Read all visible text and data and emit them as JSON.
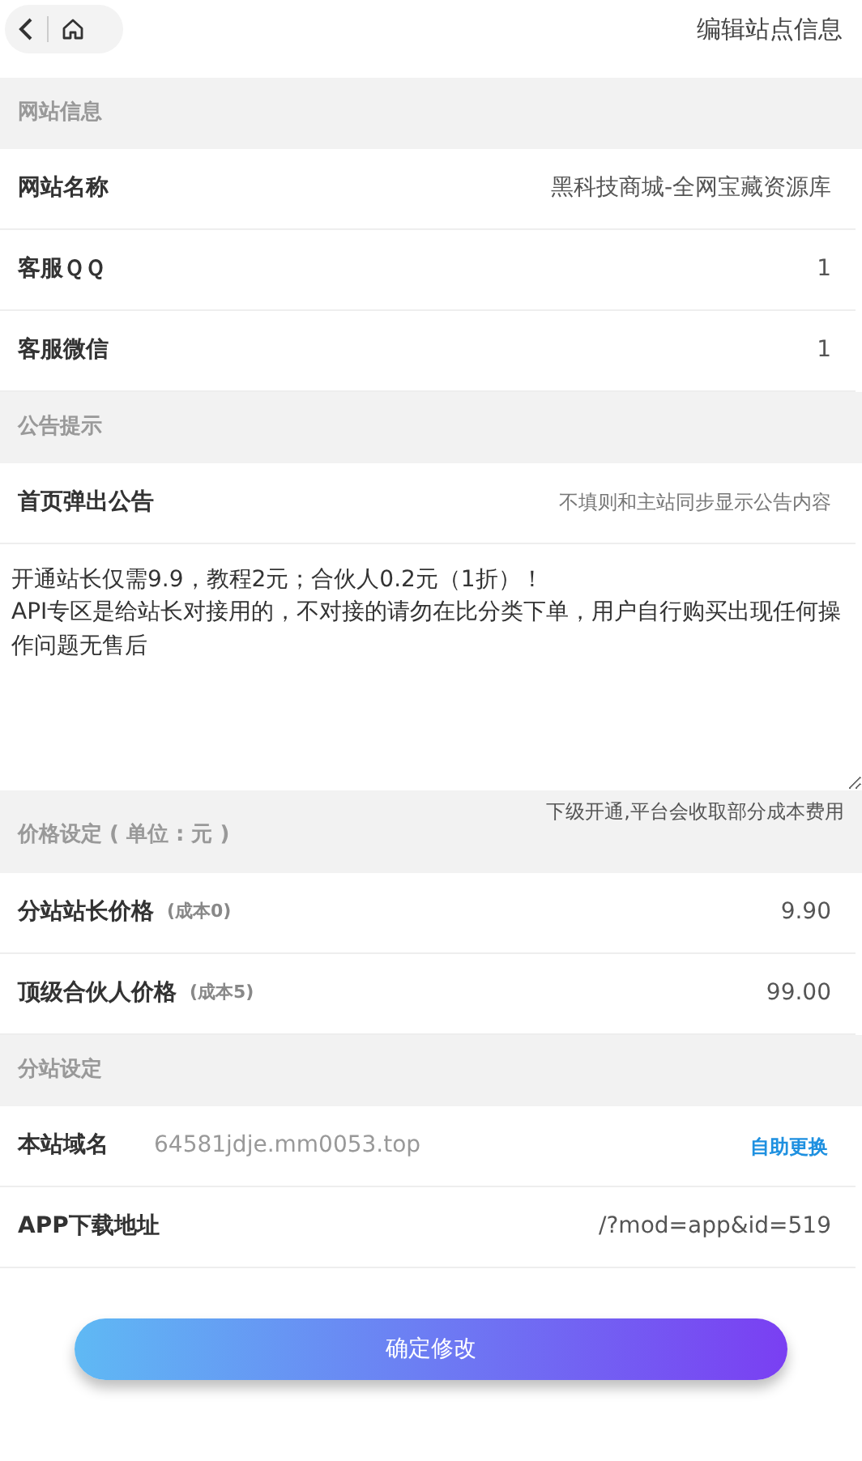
{
  "header": {
    "title": "编辑站点信息"
  },
  "sections": [
    {
      "title": "网站信息",
      "rows": [
        {
          "kind": "field",
          "label": "网站名称",
          "value": "黑科技商城-全网宝藏资源库"
        },
        {
          "kind": "field",
          "label": "客服ＱＱ",
          "value": "1"
        },
        {
          "kind": "field",
          "label": "客服微信",
          "value": "1"
        }
      ]
    },
    {
      "title": "公告提示",
      "rows": [
        {
          "kind": "field",
          "label": "首页弹出公告",
          "placeholder": "不填则和主站同步显示公告内容"
        },
        {
          "kind": "textarea",
          "value": "开通站长仅需9.9，教程2元；合伙人0.2元（1折）！\nAPI专区是给站长对接用的，不对接的请勿在比分类下单，用户自行购买出现任何操作问题无售后"
        }
      ]
    },
    {
      "title": "价格设定 ( 单位 : 元 )",
      "note": "下级开通,平台会收取部分成本费用",
      "rows": [
        {
          "kind": "field",
          "label": "分站站长价格",
          "sublabel": "(成本0)",
          "value": "9.90"
        },
        {
          "kind": "field",
          "label": "顶级合伙人价格",
          "sublabel": "(成本5)",
          "value": "99.00"
        }
      ]
    },
    {
      "title": "分站设定",
      "rows": [
        {
          "kind": "domain",
          "label": "本站域名",
          "value": "64581jdje.mm0053.top",
          "link": "自助更换"
        },
        {
          "kind": "field",
          "label": "APP下载地址",
          "value": "/?mod=app&id=519"
        }
      ]
    }
  ],
  "submit": "确定修改"
}
